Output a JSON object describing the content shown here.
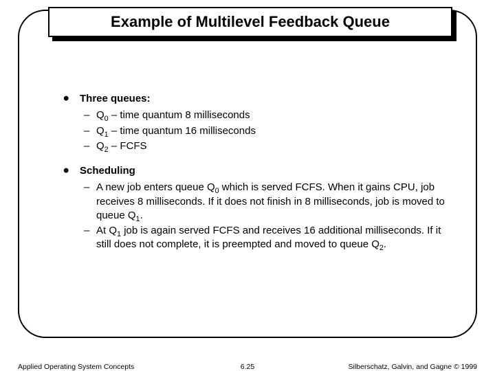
{
  "title": "Example of Multilevel Feedback Queue",
  "bullets": {
    "b1": "Three queues:",
    "b1_items": {
      "q0_pre": "Q",
      "q0_sub": "0",
      "q0_post": " – time quantum 8 milliseconds",
      "q1_pre": "Q",
      "q1_sub": "1",
      "q1_post": " – time quantum 16 milliseconds",
      "q2_pre": "Q",
      "q2_sub": "2",
      "q2_post": " – FCFS"
    },
    "b2": "Scheduling",
    "b2_items": {
      "s1_a": "A new job enters queue Q",
      "s1_sub1": "0",
      "s1_b": " which is served FCFS. When it gains CPU, job receives 8 milliseconds.  If it does not finish in 8 milliseconds, job is moved to queue Q",
      "s1_sub2": "1",
      "s1_c": ".",
      "s2_a": "At Q",
      "s2_sub1": "1",
      "s2_b": " job is again served FCFS and receives 16 additional milliseconds.  If it still does not complete, it is preempted and moved to queue Q",
      "s2_sub2": "2",
      "s2_c": "."
    }
  },
  "footer": {
    "left": "Applied Operating System Concepts",
    "center": "6.25",
    "right": "Silberschatz, Galvin, and Gagne © 1999"
  }
}
